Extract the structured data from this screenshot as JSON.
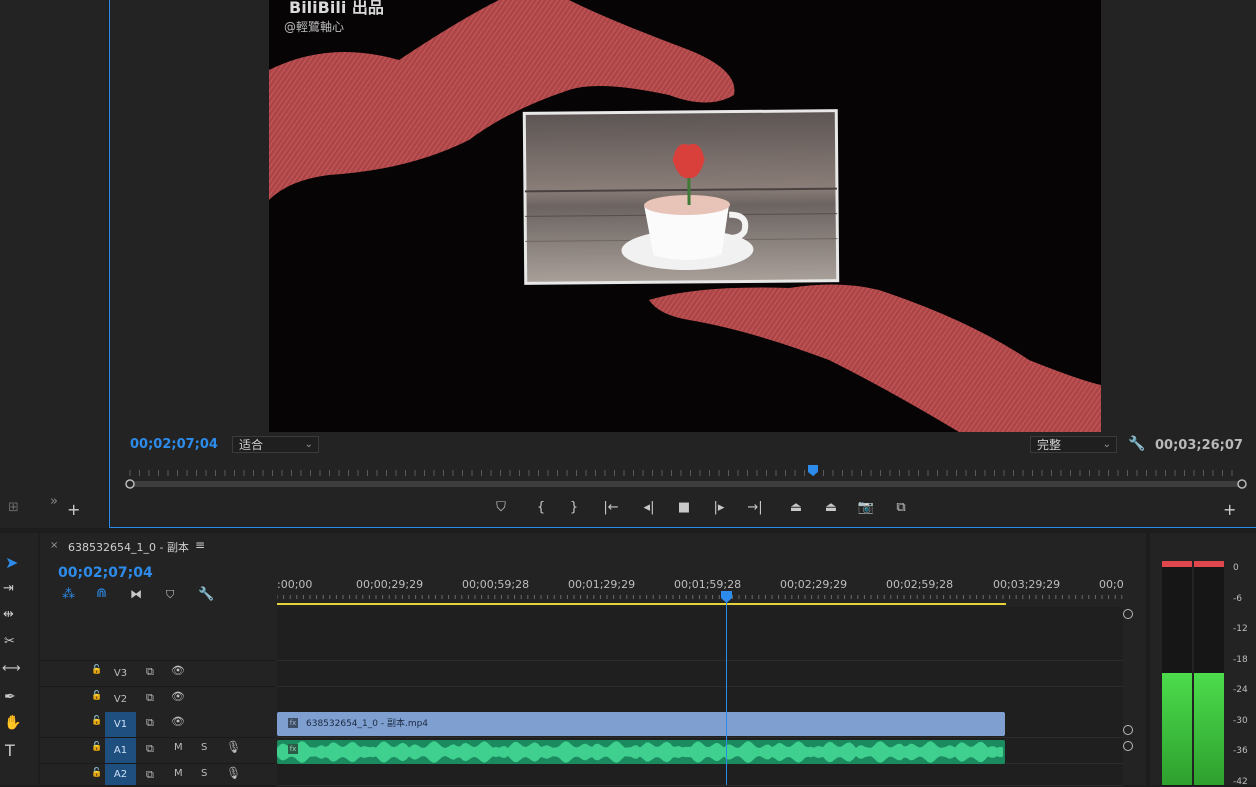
{
  "monitor": {
    "current_timecode": "00;02;07;04",
    "fit_select": "适合",
    "quality_select": "完整",
    "duration": "00;03;26;07",
    "watermark_brand": "BiliBili 出品",
    "watermark_author": "@輕鷺軸心",
    "transport_buttons": [
      {
        "name": "add-marker-button",
        "glyph": "⛉"
      },
      {
        "name": "mark-in-button",
        "glyph": "{"
      },
      {
        "name": "mark-out-button",
        "glyph": "}"
      },
      {
        "name": "go-to-in-button",
        "glyph": "|←"
      },
      {
        "name": "step-back-button",
        "glyph": "◂|"
      },
      {
        "name": "stop-button",
        "glyph": "■"
      },
      {
        "name": "step-forward-button",
        "glyph": "|▸"
      },
      {
        "name": "go-to-out-button",
        "glyph": "→|"
      },
      {
        "name": "lift-button",
        "glyph": "⏏"
      },
      {
        "name": "extract-button",
        "glyph": "⏏"
      },
      {
        "name": "export-frame-button",
        "glyph": "📷"
      },
      {
        "name": "compare-view-button",
        "glyph": "⧉"
      }
    ]
  },
  "timeline": {
    "sequence_name": "638532654_1_0 - 副本",
    "current_timecode": "00;02;07;04",
    "ruler_labels": [
      ":00;00",
      "00;00;29;29",
      "00;00;59;28",
      "00;01;29;29",
      "00;01;59;28",
      "00;02;29;29",
      "00;02;59;28",
      "00;03;29;29",
      "00;0"
    ],
    "tracks": [
      {
        "name": "V3",
        "kind": "video",
        "active": false
      },
      {
        "name": "V2",
        "kind": "video",
        "active": false
      },
      {
        "name": "V1",
        "kind": "video",
        "active": true
      },
      {
        "name": "A1",
        "kind": "audio",
        "active": true
      },
      {
        "name": "A2",
        "kind": "audio",
        "active": true
      }
    ],
    "audio_m": "M",
    "audio_s": "S",
    "video_clip_label": "638532654_1_0 - 副本.mp4",
    "fx_badge": "fx"
  },
  "meter": {
    "db_labels": [
      "0",
      "-6",
      "-12",
      "-18",
      "-24",
      "-30",
      "-36",
      "-42"
    ],
    "level_fraction": 0.5
  },
  "colors": {
    "accent_blue": "#2d8ceb",
    "video_clip": "#7e9fd0",
    "audio_clip": "#2fb481",
    "meter_green": "#3cc83c",
    "meter_peak": "#e0474c",
    "in_out_bar": "#e6d33c"
  }
}
